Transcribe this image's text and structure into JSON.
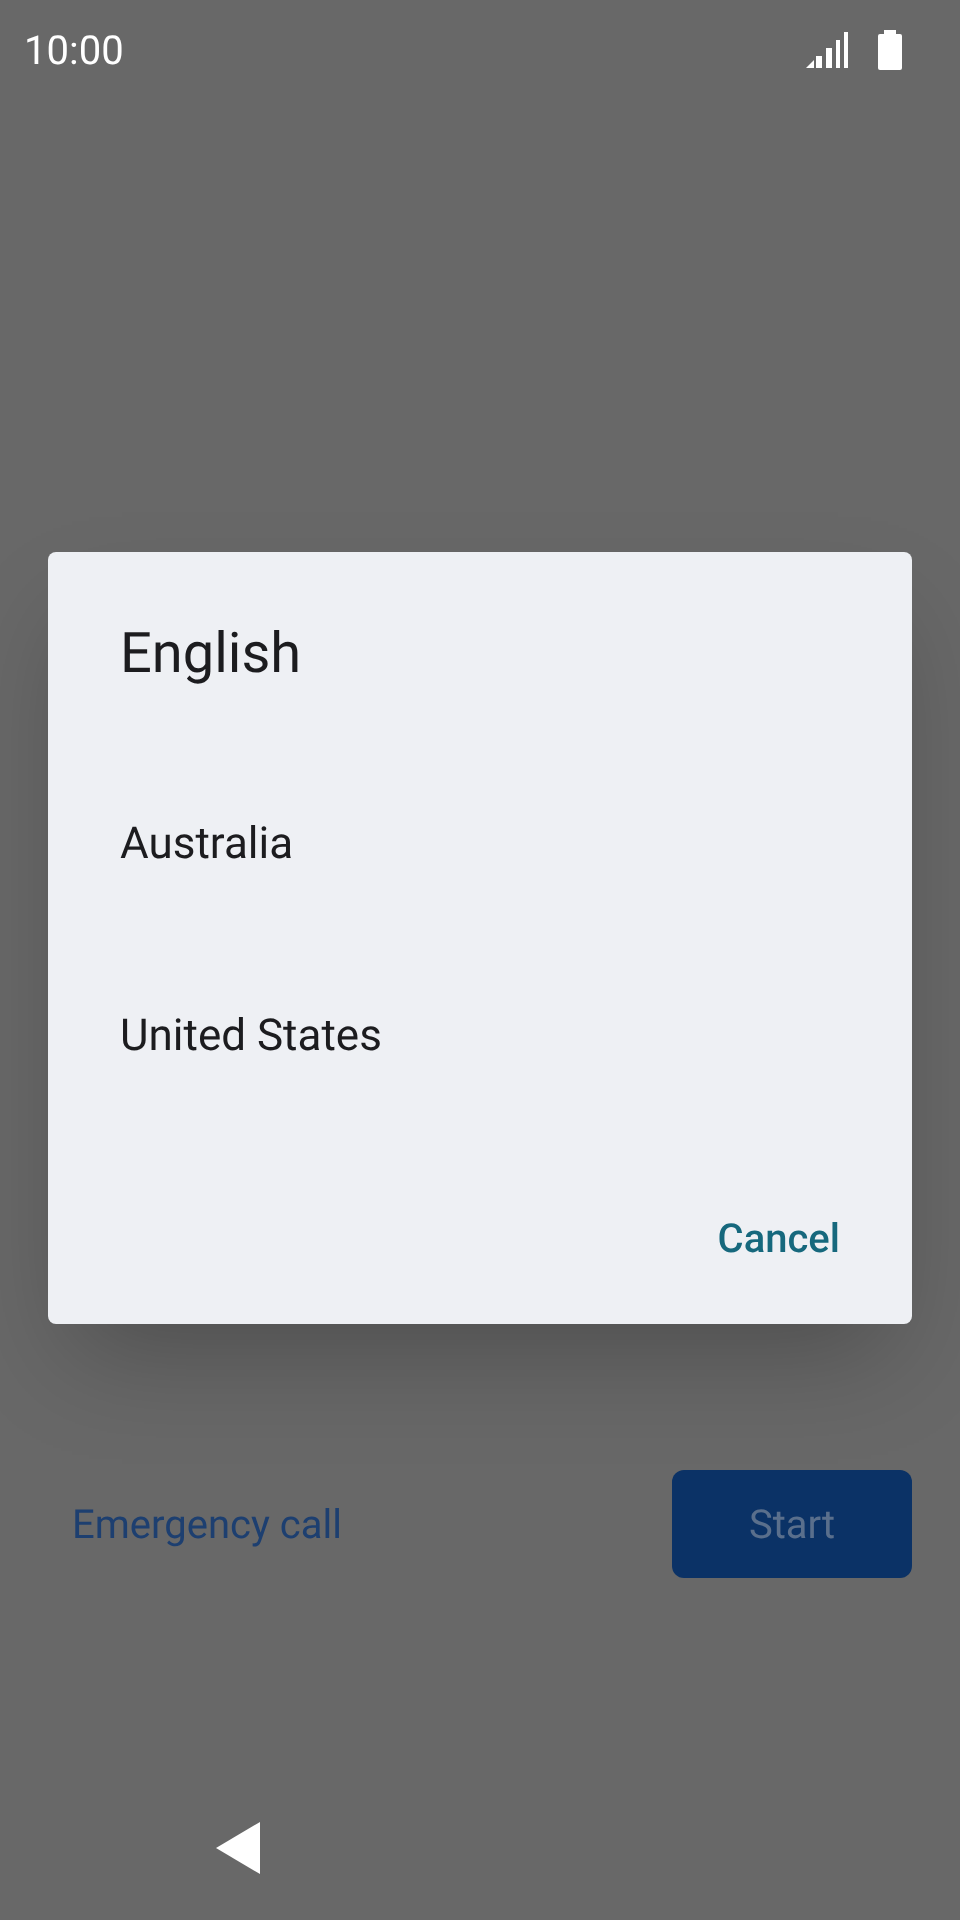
{
  "status_bar": {
    "time": "10:00"
  },
  "background": {
    "emergency_link": "Emergency call",
    "start_button": "Start"
  },
  "dialog": {
    "title": "English",
    "options": [
      {
        "label": "Australia"
      },
      {
        "label": "United States"
      }
    ],
    "cancel": "Cancel"
  }
}
